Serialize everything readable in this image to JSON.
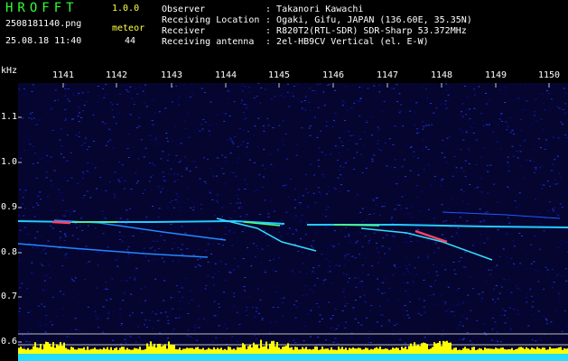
{
  "header": {
    "app_name": "HROFFT",
    "app_version": "1.0.0",
    "filename": "2508181140.png",
    "timestamp": "25.08.18 11:40",
    "meteor_label": "meteor",
    "meteor_count": "44",
    "info": [
      {
        "label": "Observer",
        "value": "Takanori Kawachi"
      },
      {
        "label": "Receiving Location",
        "value": "Ogaki, Gifu, JAPAN (136.60E, 35.35N)"
      },
      {
        "label": "Receiver",
        "value": "R820T2(RTL-SDR) SDR-Sharp 53.372MHz"
      },
      {
        "label": "Receiving antenna",
        "value": "2el-HB9CV Vertical (el. E-W)"
      }
    ]
  },
  "axes": {
    "y_unit": "kHz",
    "y_ticks": [
      "1.1",
      "1.0",
      "0.9",
      "0.8",
      "0.7",
      "0.6"
    ],
    "x_ticks": [
      "1141",
      "1142",
      "1143",
      "1144",
      "1145",
      "1146",
      "1147",
      "1148",
      "1149",
      "1150"
    ]
  },
  "colors": {
    "title_green": "#33ff33",
    "label_yellow": "#ffff44",
    "text_white": "#ffffff",
    "background": "#000000",
    "noise_blue": "#0a0a8c",
    "signal_cyan": "#22ccff",
    "signal_green": "#55ff77",
    "signal_red": "#ff4466",
    "level_yellow": "#ffff00",
    "baseline_cyan": "#22ddff"
  }
}
